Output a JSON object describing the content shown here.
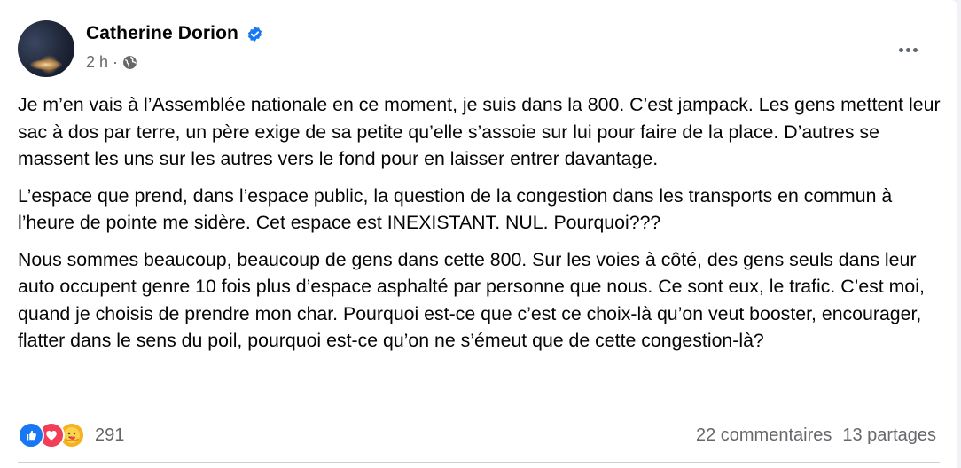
{
  "post": {
    "author": "Catherine Dorion",
    "time": "2 h",
    "separator": "·",
    "paragraphs": [
      "Je m’en vais à l’Assemblée nationale en ce moment, je suis dans la 800. C’est jampack. Les gens mettent leur sac à dos par terre, un père exige de sa petite qu’elle s’assoie sur lui pour faire de la place. D’autres se massent les uns sur les autres vers le fond pour en laisser entrer davantage.",
      "L’espace que prend, dans l’espace public, la question de la congestion dans les transports en commun à l’heure de pointe me sidère. Cet espace est INEXISTANT. NUL. Pourquoi???",
      "Nous sommes beaucoup, beaucoup de gens dans cette 800. Sur les voies à côté, des gens seuls dans leur auto occupent genre 10 fois plus d’espace asphalté par personne que nous. Ce sont eux, le trafic. C’est moi, quand je choisis de prendre mon char. Pourquoi est-ce que c’est ce choix-là qu’on veut booster, encourager, flatter dans le sens du poil, pourquoi est-ce qu’on ne s’émeut que de cette congestion-là?"
    ],
    "reactions": {
      "types": [
        "like-icon",
        "love-icon",
        "care-icon"
      ],
      "count": "291"
    },
    "comments": "22 commentaires",
    "shares": "13 partages"
  },
  "colors": {
    "verified": "#1877f2",
    "like": "#1877f2",
    "love": "#f33e58",
    "care": "#f7b125",
    "secondary_text": "#65676b"
  }
}
